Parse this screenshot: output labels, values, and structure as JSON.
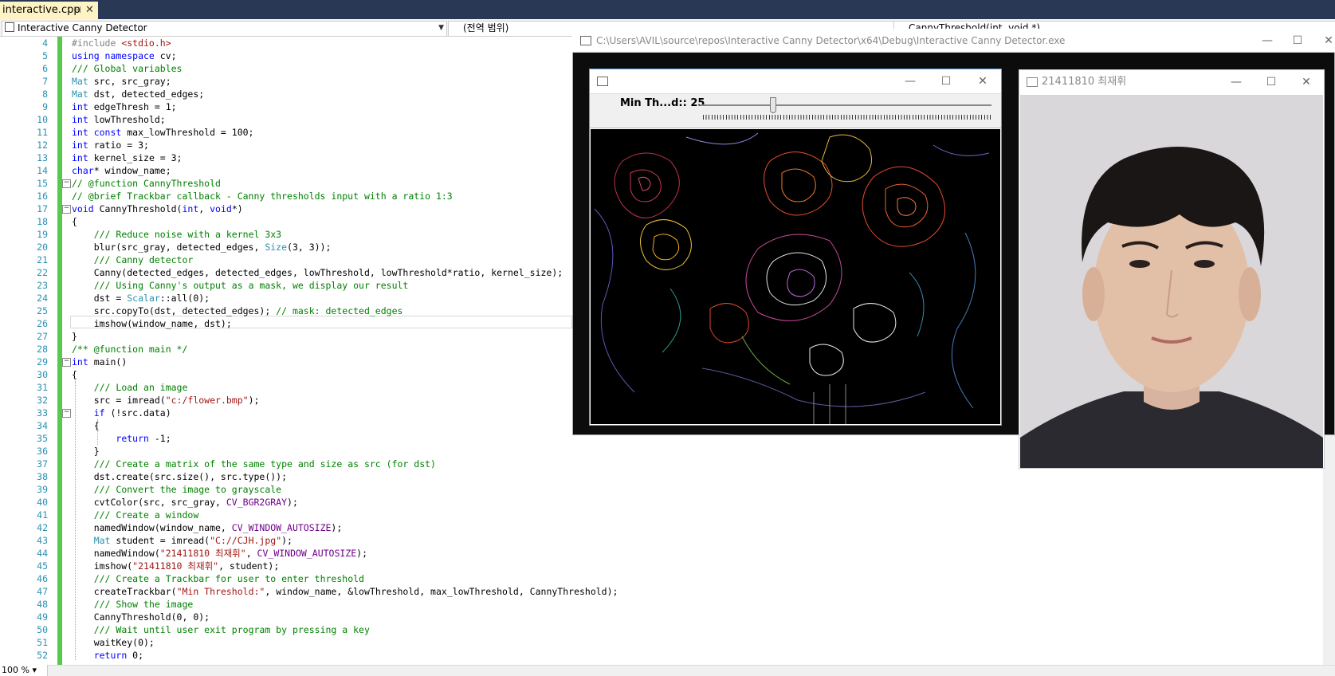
{
  "tab": {
    "filename": "interactive.cpp",
    "pin": "⊣",
    "close": "✕"
  },
  "navbar": {
    "project": "Interactive Canny Detector",
    "scope": "(전역 범위)",
    "member": "CannyThreshold(int, void *)"
  },
  "editor": {
    "zoom": "100 %",
    "line_numbers": [
      "4",
      "5",
      "6",
      "7",
      "8",
      "9",
      "10",
      "11",
      "12",
      "13",
      "14",
      "15",
      "16",
      "17",
      "18",
      "19",
      "20",
      "21",
      "22",
      "23",
      "24",
      "25",
      "26",
      "27",
      "28",
      "29",
      "30",
      "31",
      "32",
      "33",
      "34",
      "35",
      "36",
      "37",
      "38",
      "39",
      "40",
      "41",
      "42",
      "43",
      "44",
      "45",
      "46",
      "47",
      "48",
      "49",
      "50",
      "51",
      "52"
    ]
  },
  "console": {
    "title": "C:\\Users\\AVIL\\source\\repos\\Interactive Canny Detector\\x64\\Debug\\Interactive Canny Detector.exe",
    "minimize": "—",
    "maximize": "☐",
    "close": "✕"
  },
  "canny_window": {
    "trackbar_label": "Min Th...d:: 25",
    "trackbar_value": 25,
    "trackbar_max": 100,
    "minimize": "—",
    "maximize": "☐",
    "close": "✕"
  },
  "photo_window": {
    "title": "21411810 최재휘",
    "minimize": "—",
    "maximize": "☐",
    "close": "✕"
  }
}
